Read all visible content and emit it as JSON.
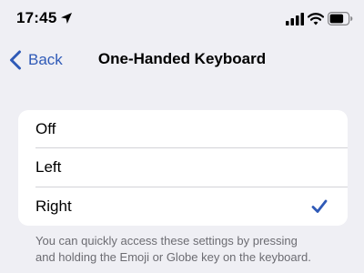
{
  "status_bar": {
    "time": "17:45",
    "icons": [
      "location-arrow-icon",
      "cellular-signal-icon",
      "wifi-icon",
      "battery-icon"
    ]
  },
  "nav": {
    "back_label": "Back",
    "title": "One-Handed Keyboard"
  },
  "options": [
    {
      "label": "Off",
      "selected": false
    },
    {
      "label": "Left",
      "selected": false
    },
    {
      "label": "Right",
      "selected": true
    }
  ],
  "footer": {
    "line1": "You can quickly access these settings by pressing",
    "line2": "and holding the Emoji or Globe key on the keyboard."
  },
  "colors": {
    "background": "#efeff4",
    "accent": "#2f5ab7",
    "card": "#ffffff",
    "footer_text": "#6c6c72"
  }
}
